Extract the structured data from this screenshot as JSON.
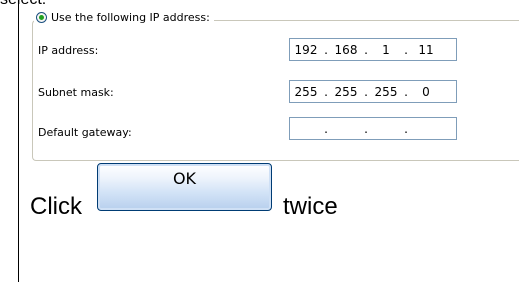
{
  "top_text": "select:",
  "group": {
    "legend": "Use the following IP address:",
    "rows": [
      {
        "label": "IP address:",
        "value_segments": [
          "192",
          "168",
          "1",
          "11"
        ]
      },
      {
        "label": "Subnet mask:",
        "value_segments": [
          "255",
          "255",
          "255",
          "0"
        ]
      },
      {
        "label": "Default gateway:",
        "value_segments": [
          "",
          "",
          "",
          ""
        ]
      }
    ]
  },
  "instruction": {
    "before": "Click",
    "button_label": "OK",
    "after": "twice"
  }
}
